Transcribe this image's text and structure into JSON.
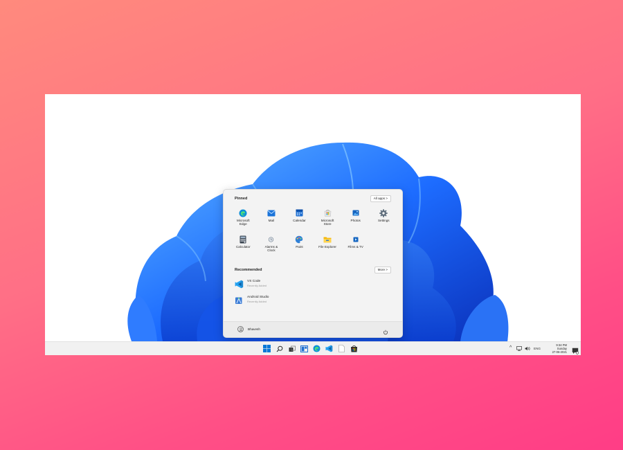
{
  "start_menu": {
    "pinned_title": "Pinned",
    "all_apps_label": "All apps  >",
    "pinned": [
      {
        "label": "Microsoft\nEdge",
        "icon": "edge-icon"
      },
      {
        "label": "Mail",
        "icon": "mail-icon"
      },
      {
        "label": "Calendar",
        "icon": "calendar-icon"
      },
      {
        "label": "Microsoft\nStore",
        "icon": "store-icon"
      },
      {
        "label": "Photos",
        "icon": "photos-icon"
      },
      {
        "label": "Settings",
        "icon": "gear-icon"
      },
      {
        "label": "Calculator",
        "icon": "calculator-icon"
      },
      {
        "label": "Alarms &\nClock",
        "icon": "alarm-clock-icon"
      },
      {
        "label": "Paint",
        "icon": "paint-icon"
      },
      {
        "label": "File Explorer",
        "icon": "folder-icon"
      },
      {
        "label": "Films & TV",
        "icon": "films-icon"
      }
    ],
    "recommended_title": "Recommended",
    "more_label": "More  >",
    "recommended": [
      {
        "name": "VS Code",
        "sub": "Recently Added",
        "icon": "vscode-icon"
      },
      {
        "name": "Android Studio",
        "sub": "Recently Added",
        "icon": "android-studio-icon"
      }
    ],
    "user_name": "Bhavesh"
  },
  "tray": {
    "language": "ENG",
    "time": "9:34 PM",
    "day": "Sunday",
    "date": "27-06-2021"
  },
  "colors": {
    "accent": "#0067c0",
    "wallpaper_blue": "#1a6bff",
    "background_top": "#ff8a7d",
    "background_bottom": "#ff3d86"
  }
}
